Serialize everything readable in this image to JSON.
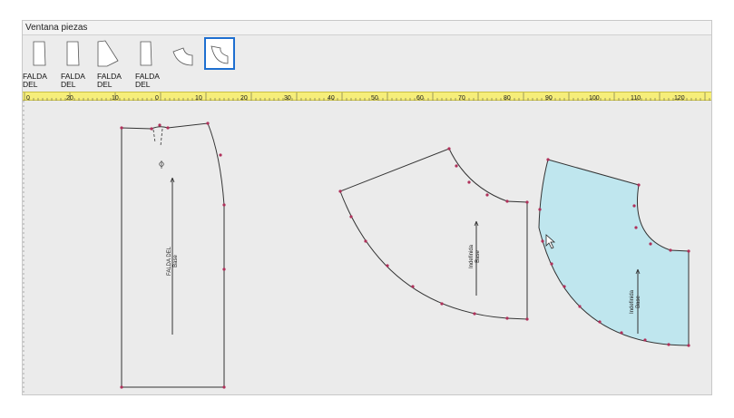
{
  "window": {
    "title": "Ventana piezas"
  },
  "thumbnails": [
    {
      "label": "FALDA DEL",
      "icon": "front-skirt-piece-icon"
    },
    {
      "label": "FALDA DEL",
      "icon": "back-skirt-piece-icon"
    },
    {
      "label": "FALDA DEL",
      "icon": "flared-skirt-piece-icon"
    },
    {
      "label": "FALDA DEL",
      "icon": "straight-skirt-piece-icon"
    },
    {
      "label": "",
      "icon": "circle-skirt-piece-icon"
    },
    {
      "label": "",
      "icon": "circle-skirt-piece-selected-icon",
      "selected": true
    }
  ],
  "ruler": {
    "ticks": [
      "0",
      "20",
      "10",
      "0",
      "10",
      "20",
      "30",
      "40",
      "50",
      "60",
      "70",
      "80",
      "90",
      "100",
      "110",
      "120"
    ]
  },
  "pieces": [
    {
      "name": "FALDA DEL",
      "sub": "Base"
    },
    {
      "name": "Indefinida",
      "sub": "Base"
    },
    {
      "name": "Indefinida",
      "sub": "Base"
    }
  ],
  "colors": {
    "selected_fill": "#bfe6ee",
    "point": "#b0305a",
    "ruler": "#f6ee7a",
    "selection_border": "#1e6fd0"
  }
}
